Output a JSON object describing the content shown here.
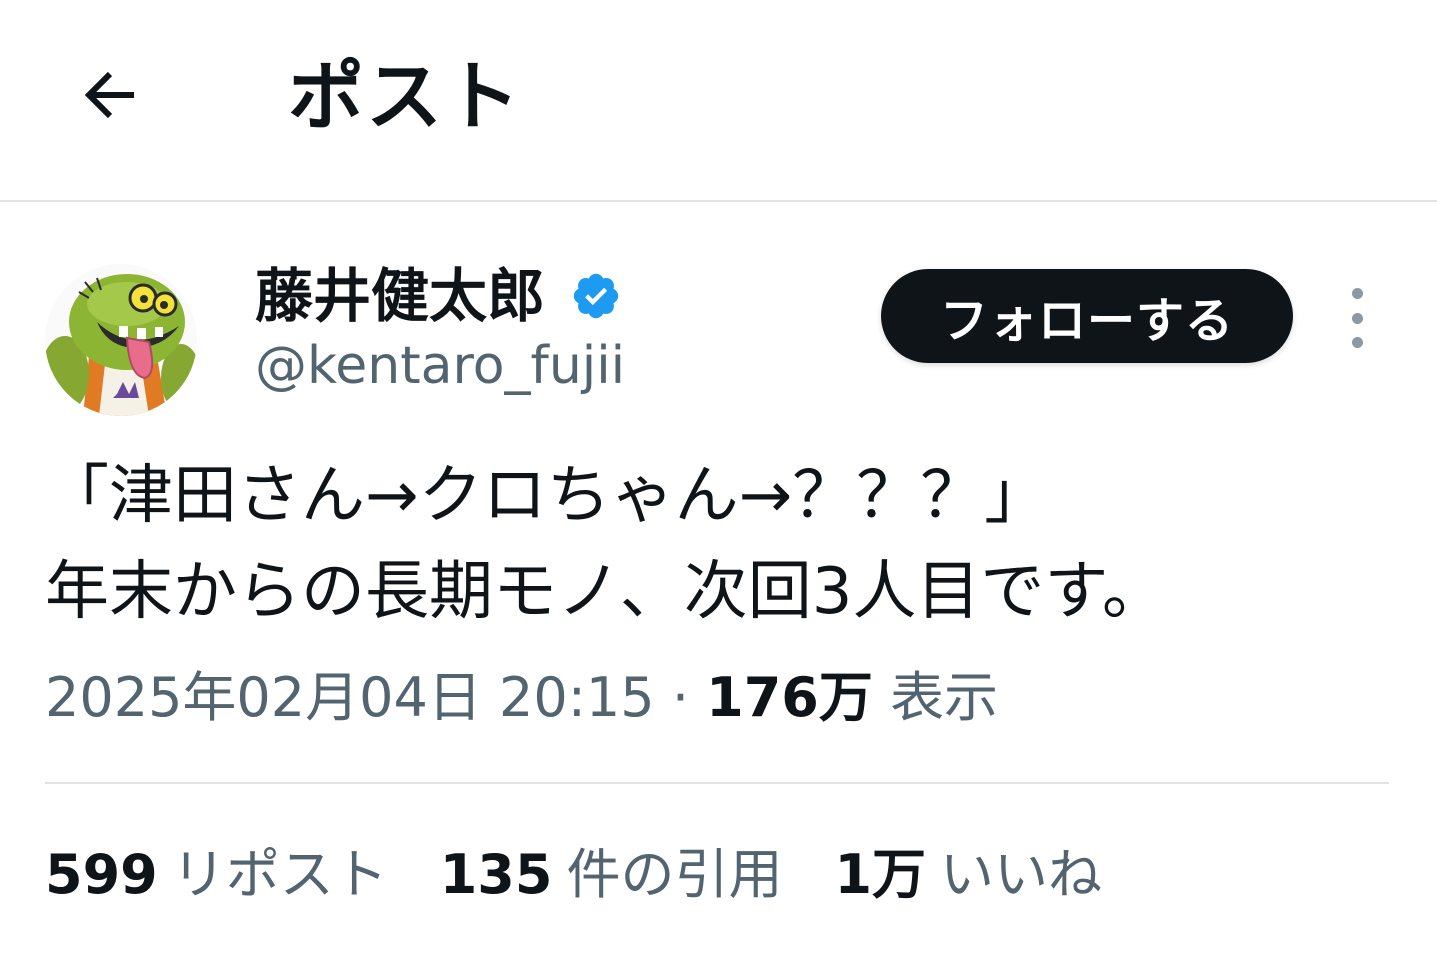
{
  "header": {
    "back_icon": "arrow-left-icon",
    "title": "ポスト"
  },
  "author": {
    "display_name": "藤井健太郎",
    "verified_icon": "verified-badge-icon",
    "verified_color": "#1d9bf0",
    "handle": "@kentaro_fujii",
    "follow_label": "フォローする",
    "more_icon": "more-vertical-icon"
  },
  "post": {
    "text": "「津田さん→クロちゃん→？？？」\n年末からの長期モノ、次回3人目です。",
    "timestamp": "2025年02月04日 20:15",
    "separator": "·",
    "views_count": "176万",
    "views_label": "表示"
  },
  "stats": {
    "reposts_count": "599",
    "reposts_label": "リポスト",
    "quotes_count": "135",
    "quotes_label": "件の引用",
    "likes_count": "1万",
    "likes_label": "いいね"
  },
  "colors": {
    "text_primary": "#0f1419",
    "text_secondary": "#536471",
    "follow_button_bg": "#0f1419",
    "divider": "#dfe3e6"
  }
}
